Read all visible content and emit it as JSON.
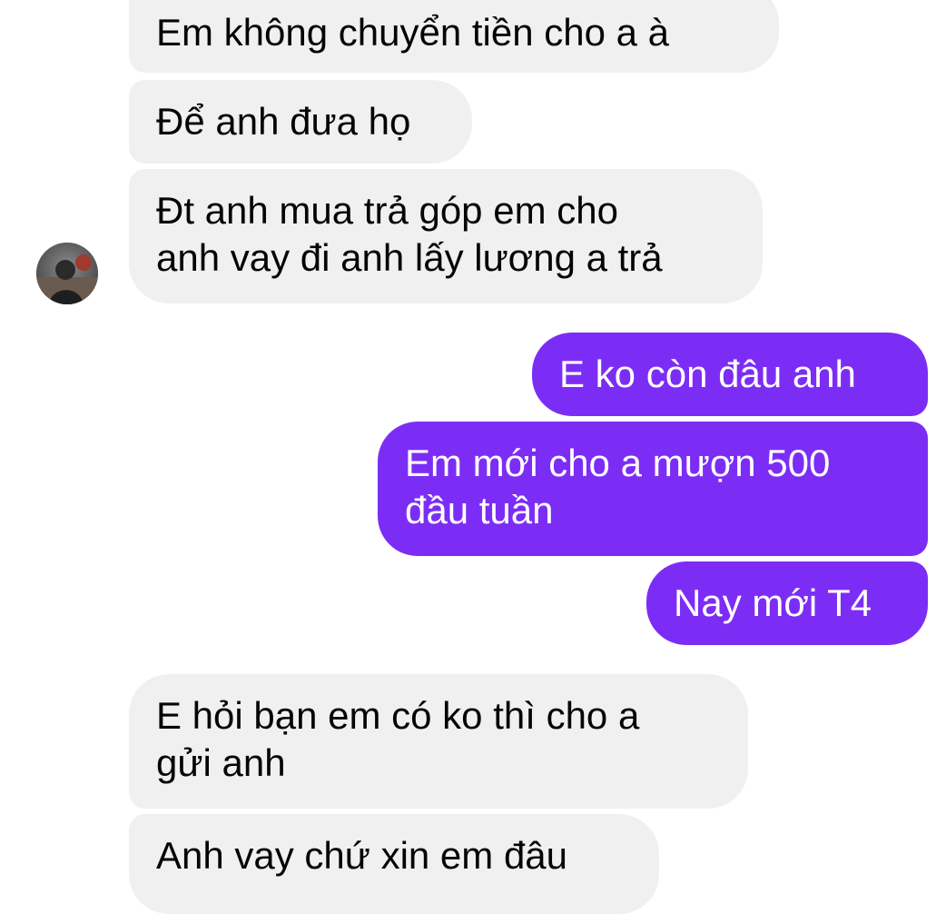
{
  "conversation": {
    "received": [
      {
        "text": "Em không chuyển tiền cho a à"
      },
      {
        "text": "Để anh đưa họ"
      },
      {
        "text": "Đt anh mua trả góp em cho\nanh vay đi anh lấy lương a trả"
      },
      {
        "text": "E hỏi bạn em có ko thì cho a\ngửi anh"
      },
      {
        "text": "Anh vay chứ xin em đâu"
      }
    ],
    "sent": [
      {
        "text": "E ko còn đâu anh"
      },
      {
        "text": "Em mới cho a mượn 500\nđầu tuần"
      },
      {
        "text": "Nay mới T4"
      }
    ]
  },
  "colors": {
    "received_bubble": "#f0f0f0",
    "sent_bubble": "#7c2df5",
    "received_text": "#050505",
    "sent_text": "#ffffff"
  },
  "icons": {
    "avatar": "profile-photo"
  }
}
